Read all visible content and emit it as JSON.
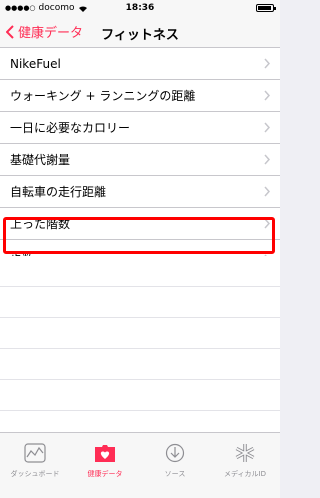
{
  "status_bar": {
    "carrier": "docomo",
    "time": "18:36"
  },
  "nav": {
    "back_label": "健康データ",
    "title": "フィットネス"
  },
  "rows": [
    {
      "label": "NikeFuel"
    },
    {
      "label": "ウォーキング + ランニングの距離"
    },
    {
      "label": "一日に必要なカロリー"
    },
    {
      "label": "基礎代謝量"
    },
    {
      "label": "自転車の走行距離"
    },
    {
      "label": "上った階数"
    },
    {
      "label": "歩数"
    }
  ],
  "tabs": [
    {
      "label": "ダッシュボード",
      "icon": "dashboard-icon"
    },
    {
      "label": "健康データ",
      "icon": "health-data-icon",
      "active": true
    },
    {
      "label": "ソース",
      "icon": "sources-icon"
    },
    {
      "label": "メディカルID",
      "icon": "medical-id-icon"
    }
  ],
  "colors": {
    "accent": "#ff2d55",
    "highlight": "#ff0000"
  }
}
